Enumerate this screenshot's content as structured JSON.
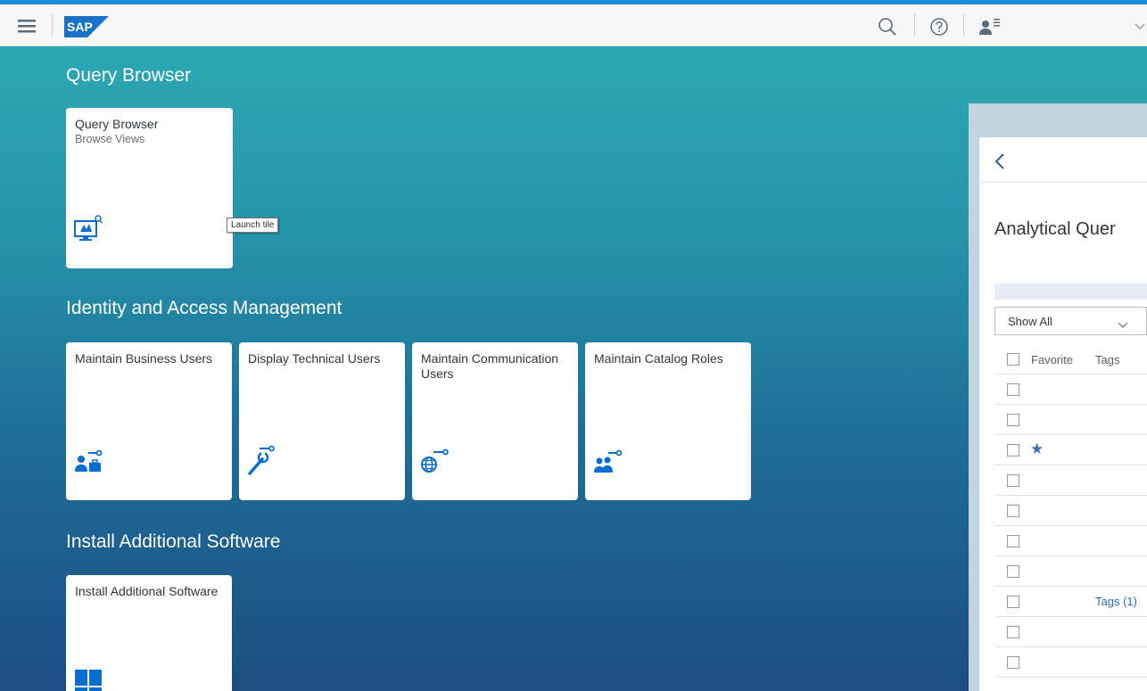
{
  "shell": {
    "logo_text": "SAP",
    "icons": [
      "hamburger-menu-icon",
      "search-icon",
      "help-icon",
      "user-menu-icon",
      "chevron-down-icon"
    ]
  },
  "groups": [
    {
      "title": "Query Browser"
    },
    {
      "title": "Identity and Access Management"
    },
    {
      "title": "Install Additional Software"
    }
  ],
  "tiles": {
    "query_browser": {
      "title": "Query Browser",
      "subtitle": "Browse Views",
      "icon": "query-browser-icon"
    },
    "maintain_business_users": {
      "title": "Maintain Business Users",
      "icon": "business-users-icon"
    },
    "display_technical_users": {
      "title": "Display Technical Users",
      "icon": "technical-users-icon"
    },
    "maintain_communication_users": {
      "title": "Maintain Communication Users",
      "icon": "communication-users-icon"
    },
    "maintain_catalog_roles": {
      "title": "Maintain Catalog Roles",
      "icon": "catalog-roles-icon"
    },
    "install_additional_software": {
      "title": "Install Additional Software",
      "icon": "install-software-icon"
    }
  },
  "tooltip": "Launch tile",
  "panel": {
    "title": "Analytical Quer",
    "filter": {
      "selected": "Show All"
    },
    "columns": [
      "Favorite",
      "Tags"
    ],
    "rows": [
      {
        "favorite": false,
        "tags": ""
      },
      {
        "favorite": false,
        "tags": ""
      },
      {
        "favorite": true,
        "tags": ""
      },
      {
        "favorite": false,
        "tags": ""
      },
      {
        "favorite": false,
        "tags": ""
      },
      {
        "favorite": false,
        "tags": ""
      },
      {
        "favorite": false,
        "tags": ""
      },
      {
        "favorite": false,
        "tags": "Tags (1)"
      },
      {
        "favorite": false,
        "tags": ""
      },
      {
        "favorite": false,
        "tags": ""
      }
    ],
    "colors": {
      "link": "#2a6fb3",
      "star": "#3a6fb4"
    }
  },
  "colors": {
    "accent": "#1d8bd8",
    "icon_blue": "#0a6ed1",
    "gradient_top": "#2ba8b3",
    "gradient_bottom": "#1c4d83"
  }
}
